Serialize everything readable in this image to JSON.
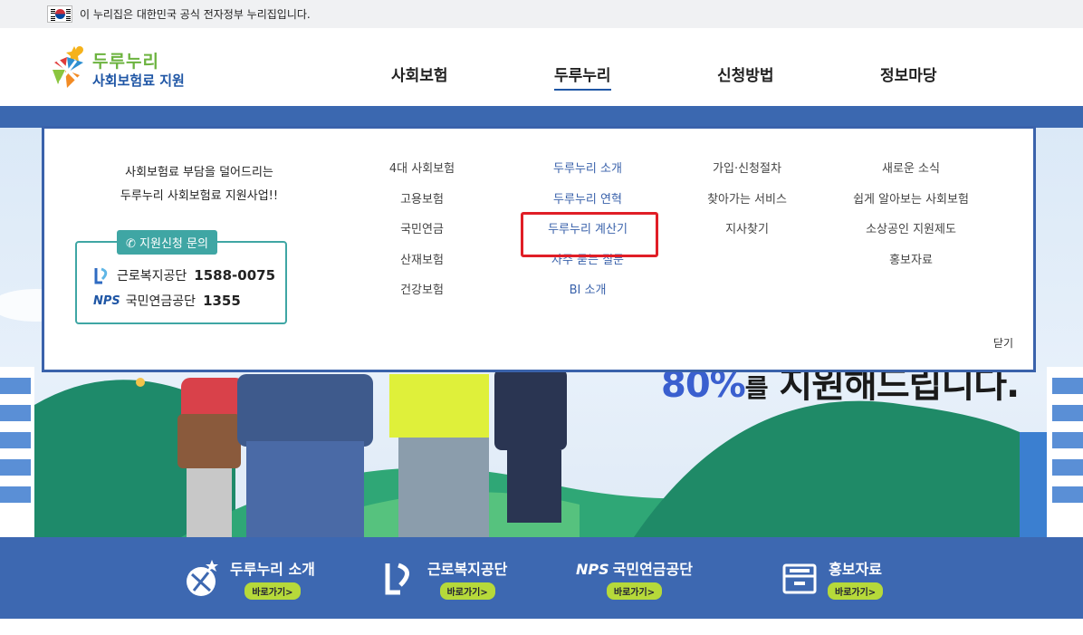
{
  "gov_banner": {
    "text": "이 누리집은 대한민국 공식 전자정부 누리집입니다."
  },
  "logo": {
    "line1": "두루누리",
    "line2": "사회보험료 지원"
  },
  "gnb": [
    {
      "label": "사회보험",
      "active": false
    },
    {
      "label": "두루누리",
      "active": true
    },
    {
      "label": "신청방법",
      "active": false
    },
    {
      "label": "정보마당",
      "active": false
    }
  ],
  "panel": {
    "intro_line1": "사회보험료 부담을 덜어드리는",
    "intro_line2": "두루누리 사회보험료 지원사업!!",
    "contact_title": "지원신청 문의",
    "contacts": [
      {
        "org": "근로복지공단",
        "phone": "1588-0075"
      },
      {
        "org": "국민연금공단",
        "phone": "1355"
      }
    ],
    "nps_logo_text": "NPS",
    "columns": [
      [
        "4대 사회보험",
        "고용보험",
        "국민연금",
        "산재보험",
        "건강보험"
      ],
      [
        "두루누리 소개",
        "두루누리 연혁",
        "두루누리 계산기",
        "자주 묻는 질문",
        "BI 소개"
      ],
      [
        "가입·신청절차",
        "찾아가는 서비스",
        "지사찾기"
      ],
      [
        "새로운 소식",
        "쉽게 알아보는 사회보험",
        "소상공인 지원제도",
        "홍보자료"
      ]
    ],
    "close_label": "닫기"
  },
  "hero": {
    "percent": "80%",
    "particle": "를",
    "text": " 지원해드립니다."
  },
  "quick_links": [
    {
      "title": "두루누리 소개",
      "go": "바로가기>"
    },
    {
      "title": "근로복지공단",
      "go": "바로가기>"
    },
    {
      "title": "국민연금공단",
      "go": "바로가기>",
      "prefix": "NPS"
    },
    {
      "title": "홍보자료",
      "go": "바로가기>"
    }
  ],
  "colors": {
    "primary": "#3d68b1",
    "accent_green": "#b6d93a",
    "teal": "#3fa6a4",
    "highlight_red": "#e01e26"
  }
}
